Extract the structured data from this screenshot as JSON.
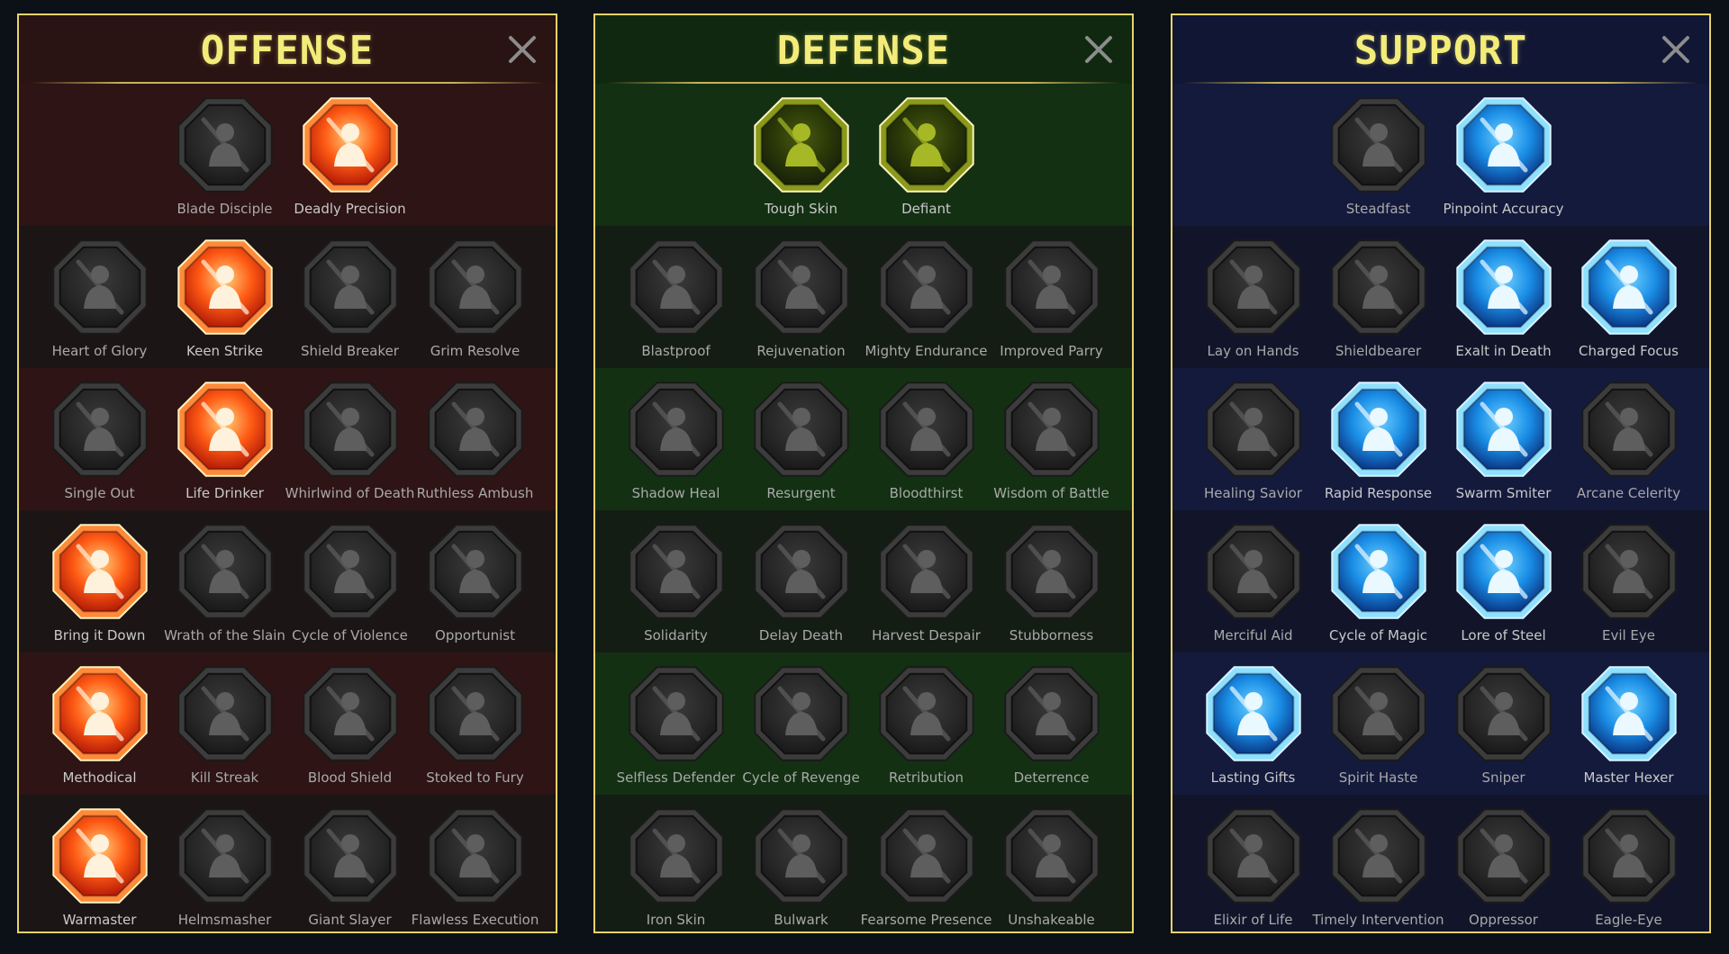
{
  "colors": {
    "title": "#f3ec7a",
    "panel_border": "#e6d36a",
    "offense_accent": "#ff6a2a",
    "defense_accent": "#b8c430",
    "support_accent": "#35b8ff",
    "inactive_icon": "#2a2a2a",
    "label": "#a9a9a9"
  },
  "panels": [
    {
      "id": "offense",
      "title": "OFFENSE",
      "close_icon": "close-icon",
      "tiers": [
        [
          {
            "label": "Blade Disciple",
            "active": false,
            "icon": "crossed-swords-icon"
          },
          {
            "label": "Deadly Precision",
            "active": true,
            "icon": "dagger-slash-icon"
          }
        ],
        [
          {
            "label": "Heart of Glory",
            "active": false,
            "icon": "horned-heart-icon"
          },
          {
            "label": "Keen Strike",
            "active": true,
            "icon": "spear-strike-icon"
          },
          {
            "label": "Shield Breaker",
            "active": false,
            "icon": "broken-shield-icon"
          },
          {
            "label": "Grim Resolve",
            "active": false,
            "icon": "crowned-heart-icon"
          }
        ],
        [
          {
            "label": "Single Out",
            "active": false,
            "icon": "target-figure-icon"
          },
          {
            "label": "Life Drinker",
            "active": true,
            "icon": "fangs-icon"
          },
          {
            "label": "Whirlwind of Death",
            "active": false,
            "icon": "whirlwind-skull-icon"
          },
          {
            "label": "Ruthless Ambush",
            "active": false,
            "icon": "dagger-hand-icon"
          }
        ],
        [
          {
            "label": "Bring it Down",
            "active": true,
            "icon": "sword-heart-icon"
          },
          {
            "label": "Wrath of the Slain",
            "active": false,
            "icon": "fist-blade-icon"
          },
          {
            "label": "Cycle of Violence",
            "active": false,
            "icon": "axe-cycle-icon"
          },
          {
            "label": "Opportunist",
            "active": false,
            "icon": "chain-bolt-icon"
          }
        ],
        [
          {
            "label": "Methodical",
            "active": true,
            "icon": "arrows-target-icon"
          },
          {
            "label": "Kill Streak",
            "active": false,
            "icon": "triple-skull-icon"
          },
          {
            "label": "Blood Shield",
            "active": false,
            "icon": "blood-sword-icon"
          },
          {
            "label": "Stoked to Fury",
            "active": false,
            "icon": "fury-figure-icon"
          }
        ],
        [
          {
            "label": "Warmaster",
            "active": true,
            "icon": "hammer-sparks-icon"
          },
          {
            "label": "Helmsmasher",
            "active": false,
            "icon": "knight-helm-icon"
          },
          {
            "label": "Giant Slayer",
            "active": false,
            "icon": "giant-icon"
          },
          {
            "label": "Flawless Execution",
            "active": false,
            "icon": "skull-sword-icon"
          }
        ]
      ]
    },
    {
      "id": "defense",
      "title": "DEFENSE",
      "close_icon": "close-icon",
      "tiers": [
        [
          {
            "label": "Tough Skin",
            "active": true,
            "icon": "scales-icon"
          },
          {
            "label": "Defiant",
            "active": true,
            "icon": "raised-fist-icon"
          }
        ],
        [
          {
            "label": "Blastproof",
            "active": false,
            "icon": "layered-shield-icon"
          },
          {
            "label": "Rejuvenation",
            "active": false,
            "icon": "heart-organ-icon"
          },
          {
            "label": "Mighty Endurance",
            "active": false,
            "icon": "armored-figure-icon"
          },
          {
            "label": "Improved Parry",
            "active": false,
            "icon": "crossed-blades-icon"
          }
        ],
        [
          {
            "label": "Shadow Heal",
            "active": false,
            "icon": "shadow-figure-icon"
          },
          {
            "label": "Resurgent",
            "active": false,
            "icon": "knight-shield-icon"
          },
          {
            "label": "Bloodthirst",
            "active": false,
            "icon": "skull-heart-icon"
          },
          {
            "label": "Wisdom of Battle",
            "active": false,
            "icon": "hooded-face-icon"
          }
        ],
        [
          {
            "label": "Solidarity",
            "active": false,
            "icon": "group-figures-icon"
          },
          {
            "label": "Delay Death",
            "active": false,
            "icon": "hourglass-icon"
          },
          {
            "label": "Harvest Despair",
            "active": false,
            "icon": "open-hand-icon"
          },
          {
            "label": "Stubborness",
            "active": false,
            "icon": "bull-head-icon"
          }
        ],
        [
          {
            "label": "Selfless Defender",
            "active": false,
            "icon": "running-shield-icon"
          },
          {
            "label": "Cycle of Revenge",
            "active": false,
            "icon": "drops-icon"
          },
          {
            "label": "Retribution",
            "active": false,
            "icon": "spiked-skull-icon"
          },
          {
            "label": "Deterrence",
            "active": false,
            "icon": "deflect-hand-icon"
          }
        ],
        [
          {
            "label": "Iron Skin",
            "active": false,
            "icon": "crowned-figure-icon"
          },
          {
            "label": "Bulwark",
            "active": false,
            "icon": "winged-shield-icon"
          },
          {
            "label": "Fearsome Presence",
            "active": false,
            "icon": "ghost-skull-icon"
          },
          {
            "label": "Unshakeable",
            "active": false,
            "icon": "strong-figure-icon"
          }
        ]
      ]
    },
    {
      "id": "support",
      "title": "SUPPORT",
      "close_icon": "close-icon",
      "tiers": [
        [
          {
            "label": "Steadfast",
            "active": false,
            "icon": "heart-plus-icon"
          },
          {
            "label": "Pinpoint Accuracy",
            "active": true,
            "icon": "bullseye-icon"
          }
        ],
        [
          {
            "label": "Lay on Hands",
            "active": false,
            "icon": "praying-hands-icon"
          },
          {
            "label": "Shieldbearer",
            "active": false,
            "icon": "ringed-shield-icon"
          },
          {
            "label": "Exalt in Death",
            "active": true,
            "icon": "flaming-skull-icon"
          },
          {
            "label": "Charged Focus",
            "active": true,
            "icon": "charged-beam-icon"
          }
        ],
        [
          {
            "label": "Healing Savior",
            "active": false,
            "icon": "healer-figure-icon"
          },
          {
            "label": "Rapid Response",
            "active": true,
            "icon": "lightning-cycle-icon"
          },
          {
            "label": "Swarm Smiter",
            "active": true,
            "icon": "zigzag-bolt-icon"
          },
          {
            "label": "Arcane Celerity",
            "active": false,
            "icon": "speed-figure-icon"
          }
        ],
        [
          {
            "label": "Merciful Aid",
            "active": false,
            "icon": "chained-heart-icon"
          },
          {
            "label": "Cycle of Magic",
            "active": true,
            "icon": "comet-cycle-icon"
          },
          {
            "label": "Lore of Steel",
            "active": true,
            "icon": "open-book-icon"
          },
          {
            "label": "Evil Eye",
            "active": false,
            "icon": "evil-eye-icon"
          }
        ],
        [
          {
            "label": "Lasting Gifts",
            "active": true,
            "icon": "compass-star-icon"
          },
          {
            "label": "Spirit Haste",
            "active": false,
            "icon": "winged-boot-icon"
          },
          {
            "label": "Sniper",
            "active": false,
            "icon": "eye-icon"
          },
          {
            "label": "Master Hexer",
            "active": true,
            "icon": "voodoo-doll-icon"
          }
        ],
        [
          {
            "label": "Elixir of Life",
            "active": false,
            "icon": "potion-flask-icon"
          },
          {
            "label": "Timely Intervention",
            "active": false,
            "icon": "winged-skull-icon"
          },
          {
            "label": "Oppressor",
            "active": false,
            "icon": "crushing-fist-icon"
          },
          {
            "label": "Eagle-Eye",
            "active": false,
            "icon": "eagle-head-icon"
          }
        ]
      ]
    }
  ]
}
